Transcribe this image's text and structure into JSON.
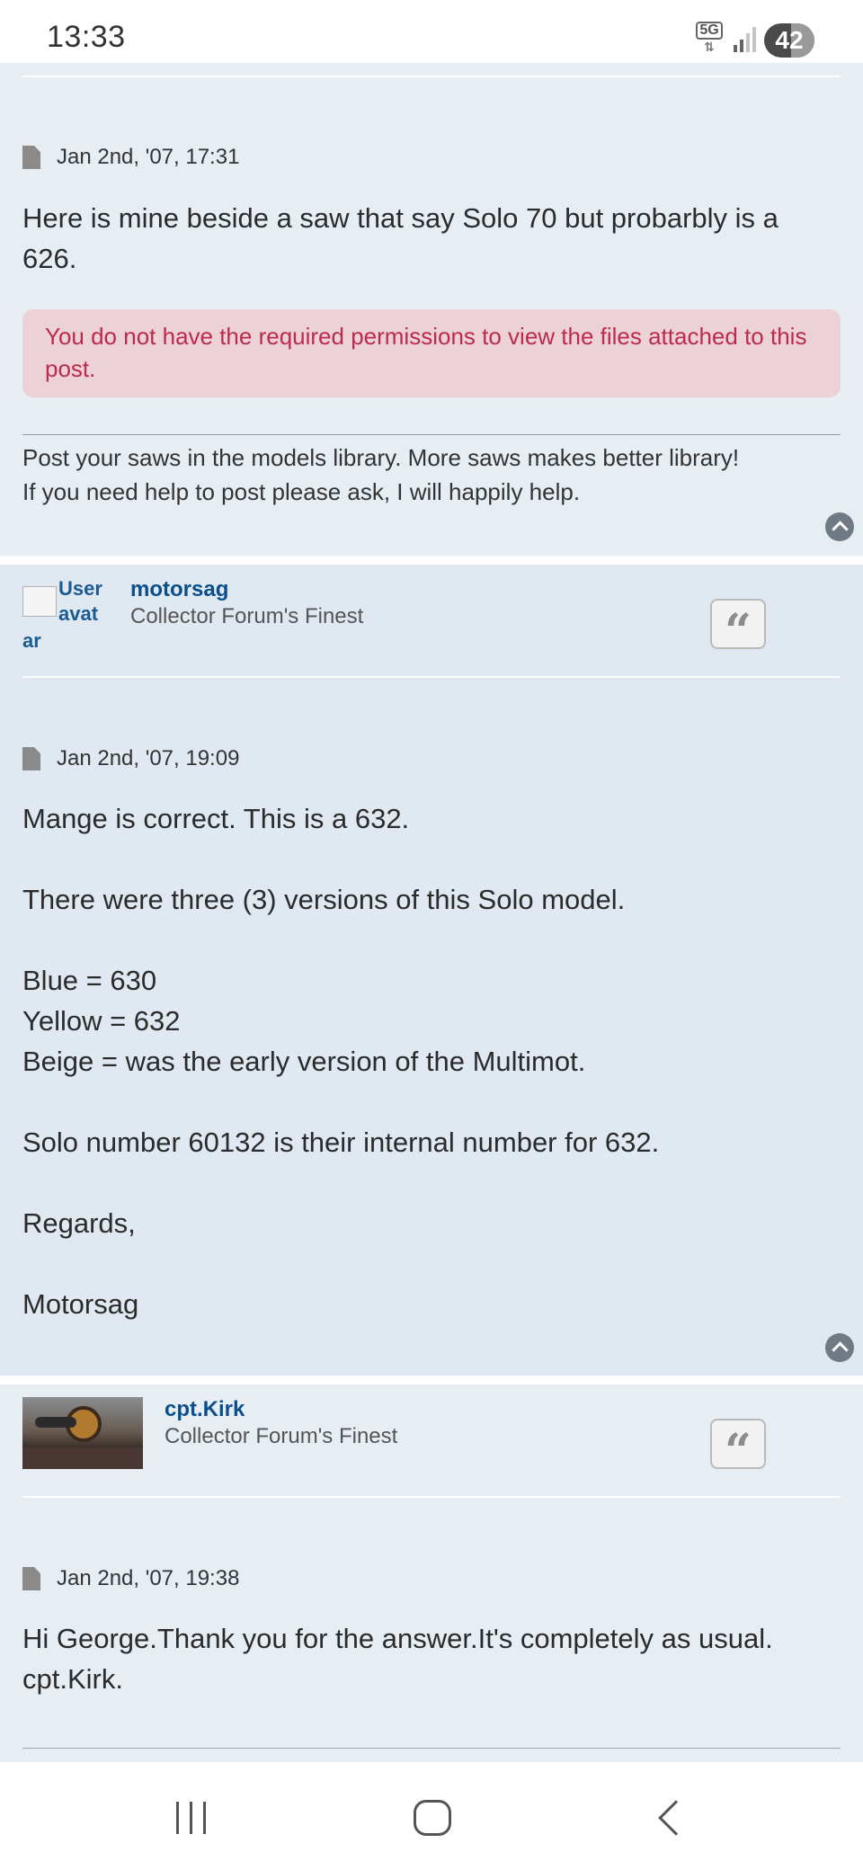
{
  "status_bar": {
    "time": "13:33",
    "network": "5G",
    "battery": "42"
  },
  "posts": [
    {
      "date": "Jan 2nd, '07, 17:31",
      "content": "Here is mine beside a saw that say Solo 70 but probarbly is a 626.",
      "notice": "You do not have the required permissions to view the files attached to this post.",
      "signature_line1": "Post your saws in the models library. More saws makes better library!",
      "signature_line2": "If you need help to post please ask, I will happily help."
    },
    {
      "author": "motorsag",
      "rank": "Collector Forum's Finest",
      "avatar_alt_1": "User",
      "avatar_alt_2": "avat",
      "avatar_alt_3": "ar",
      "date": "Jan 2nd, '07, 19:09",
      "content": "Mange is correct. This is a 632.\n\nThere were three (3) versions of this Solo model.\n\nBlue = 630\nYellow = 632\nBeige = was the early version of the Multimot.\n\nSolo number 60132 is their internal number for 632.\n\nRegards,\n\nMotorsag"
    },
    {
      "author": "cpt.Kirk",
      "rank": "Collector Forum's Finest",
      "date": "Jan 2nd, '07, 19:38",
      "content": "Hi George.Thank you for the answer.It's completely as usual.\ncpt.Kirk."
    }
  ],
  "icons": {
    "file": "file-icon",
    "quote": "quote-icon",
    "top": "chevron-up-icon"
  },
  "colors": {
    "post_bg": "#e6eef4",
    "post_bg_alt": "#e0e9f1",
    "author_link": "#0b4f8a",
    "notice_bg": "#ecd1d7",
    "notice_text": "#bc2a4d"
  }
}
